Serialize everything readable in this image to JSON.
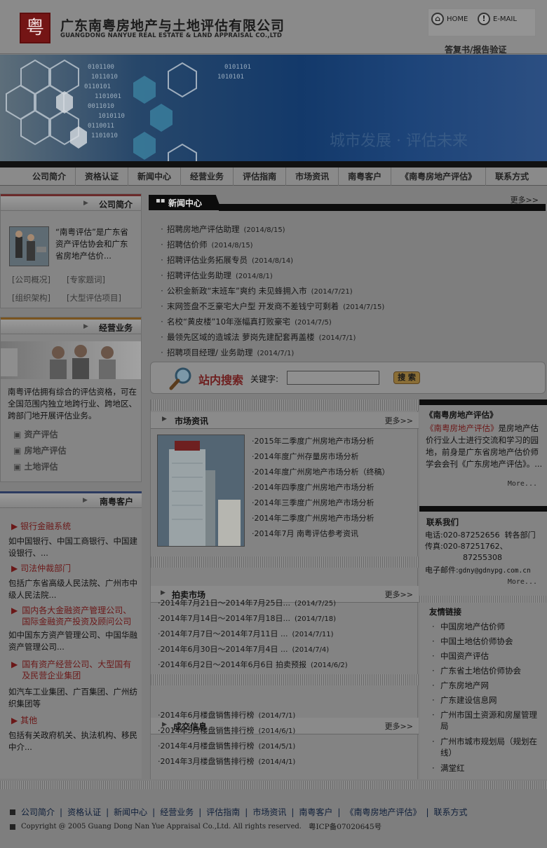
{
  "header": {
    "logo_glyph": "粤",
    "company_cn": "广东南粤房地产与土地评估有限公司",
    "company_en": "GUANGDONG NANYUE REAL ESTATE & LAND APPRAISAL CO.,LTD",
    "home_label": "HOME",
    "email_label": "E-MAIL",
    "verify_label": "答复书/报告验证"
  },
  "banner": {
    "text": "城市发展 · 评估未来"
  },
  "nav": [
    "公司简介",
    "资格认证",
    "新闻中心",
    "经营业务",
    "评估指南",
    "市场资讯",
    "南粤客户",
    "《南粤房地产评估》",
    "联系方式"
  ],
  "intro": {
    "title": "公司简介",
    "text": "“南粤评估”是广东省资产评估协会和广东省房地产估价...",
    "links": [
      "[公司概况]",
      "[专家题词]",
      "[组织架构]",
      "[大型评估项目]"
    ]
  },
  "business": {
    "title": "经营业务",
    "text": "南粤评估拥有综合的评估资格，可在全国范围内独立地跨行业、跨地区、跨部门地开展评估业务。",
    "items": [
      "资产评估",
      "房地产评估",
      "土地评估"
    ]
  },
  "clients": {
    "title": "南粤客户",
    "groups": [
      {
        "name": "银行金融系统",
        "desc": "如中国银行、中国工商银行、中国建设银行、..."
      },
      {
        "name": "司法仲裁部门",
        "desc": "包括广东省高级人民法院、广州市中级人民法院..."
      },
      {
        "name": "国内各大金融资产管理公司、国际金融资产投资及顾问公司",
        "desc": "如中国东方资产管理公司、中国华融资产管理公司..."
      },
      {
        "name": "国有资产经营公司、大型国有及民营企业集团",
        "desc": "如汽车工业集团、广百集团、广州纺织集团等"
      },
      {
        "name": "其他",
        "desc": "包括有关政府机关、执法机构、移民中介..."
      }
    ]
  },
  "news": {
    "title": "新闻中心",
    "more": "更多>>",
    "items": [
      {
        "t": "招聘房地产评估助理",
        "d": "(2014/8/15)"
      },
      {
        "t": "招聘估价师",
        "d": "(2014/8/15)"
      },
      {
        "t": "招聘评估业务拓展专员",
        "d": "(2014/8/14)"
      },
      {
        "t": "招聘评估业务助理",
        "d": "(2014/8/1)"
      },
      {
        "t": "公积金新政“末班车”爽约 未见蜂拥入市",
        "d": "(2014/7/21)"
      },
      {
        "t": "末网签盘不乏豪宅大户型 开发商不差钱宁可剩着",
        "d": "(2014/7/15)"
      },
      {
        "t": "名校“黄皮楼”10年涨幅真打败豪宅",
        "d": "(2014/7/5)"
      },
      {
        "t": "最领先区域的造城法 萝岗先建配套再盖楼",
        "d": "(2014/7/1)"
      },
      {
        "t": "招聘项目经理/ 业务助理",
        "d": "(2014/7/1)"
      }
    ]
  },
  "search": {
    "title": "站内搜索",
    "keyword_label": "关键字:",
    "button": "搜 索",
    "placeholder": ""
  },
  "market": {
    "title": "市场资讯",
    "more": "更多>>",
    "items": [
      "2015年二季度广州房地产市场分析",
      "2014年度广州存量房市场分析",
      "2014年度广州房地产市场分析（终稿）",
      "2014年四季度广州房地产市场分析",
      "2014年三季度广州房地产市场分析",
      "2014年二季度广州房地产市场分析",
      "2014年7月 南粤评估参考资讯"
    ]
  },
  "auction": {
    "title": "拍卖市场",
    "more": "更多>>",
    "items": [
      {
        "t": "2014年7月21日～2014年7月25日...",
        "d": "(2014/7/25)"
      },
      {
        "t": "2014年7月14日～2014年7月18日...",
        "d": "(2014/7/18)"
      },
      {
        "t": "2014年7月7日～2014年7月11日 ...",
        "d": "(2014/7/11)"
      },
      {
        "t": "2014年6月30日～2014年7月4日 ...",
        "d": "(2014/7/4)"
      },
      {
        "t": "2014年6月2日～2014年6月6日 拍卖预报",
        "d": "(2014/6/2)"
      }
    ]
  },
  "deals": {
    "title": "成交信息",
    "more": "更多>>",
    "items": [
      {
        "t": "2014年6月楼盘销售排行榜",
        "d": "(2014/7/1)"
      },
      {
        "t": "2014年5月楼盘销售排行榜",
        "d": "(2014/6/1)"
      },
      {
        "t": "2014年4月楼盘销售排行榜",
        "d": "(2014/5/1)"
      },
      {
        "t": "2014年3月楼盘销售排行榜",
        "d": "(2014/4/1)"
      }
    ]
  },
  "magazine": {
    "title": "《南粤房地产评估》",
    "highlight": "《南粤房地产评估》",
    "text": "是房地产估价行业人士进行交流和学习的园地，前身是广东省房地产估价师学会会刊《广东房地产评估》。...",
    "more": "More..."
  },
  "contact": {
    "title": "联系我们",
    "phone_label": "电话:",
    "phone": "020-87252656",
    "phone_note": "转各部门",
    "fax_label": "传真:",
    "fax1": "020-87251762、",
    "fax2": "87255308",
    "email_label": "电子邮件:",
    "email": "gdny@gdnypg.com.cn",
    "more": "More..."
  },
  "links": {
    "title": "友情链接",
    "items": [
      "中国房地产估价师",
      "中国土地估价师协会",
      "中国资产评估",
      "广东省土地估价师协会",
      "广东房地产网",
      "广东建设信息网",
      "广州市国土资源和房屋管理局",
      "广州市城市规划局（规划在线）",
      "满堂红"
    ]
  },
  "footer": {
    "links": [
      "公司简介",
      "资格认证",
      "新闻中心",
      "经营业务",
      "评估指南",
      "市场资讯",
      "南粤客户",
      "《南粤房地产评估》",
      "联系方式"
    ],
    "copyright": "Copyright @ 2005 Guang Dong Nan Yue Appraisal Co.,Ltd. All rights reserved.",
    "icp": "粤ICP备07020645号"
  }
}
